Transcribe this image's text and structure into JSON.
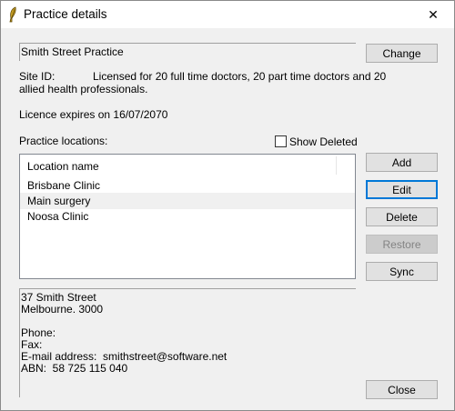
{
  "window": {
    "title": "Practice details",
    "close_glyph": "✕",
    "icon": "app-feather-icon"
  },
  "practice": {
    "name": "Smith Street Practice",
    "change_label": "Change",
    "site_id_label": "Site ID:",
    "licence_line1": "Licensed for 20 full time doctors, 20 part time doctors and 20",
    "licence_line2": "allied health professionals.",
    "licence_expiry": "Licence expires on 16/07/2070"
  },
  "locations": {
    "heading": "Practice locations:",
    "show_deleted_label": "Show Deleted",
    "show_deleted_checked": false,
    "column_header": "Location name",
    "items": [
      {
        "name": "Brisbane Clinic",
        "selected": false
      },
      {
        "name": "Main surgery",
        "selected": true
      },
      {
        "name": "Noosa Clinic",
        "selected": false
      }
    ]
  },
  "buttons": {
    "add": "Add",
    "edit": "Edit",
    "delete": "Delete",
    "restore": "Restore",
    "sync": "Sync",
    "close": "Close"
  },
  "address": {
    "street": "37 Smith Street",
    "city": "Melbourne. 3000",
    "phone": "Phone:",
    "fax": "Fax:",
    "email": "E-mail address:  smithstreet@software.net",
    "abn": "ABN:  58 725 115 040"
  }
}
